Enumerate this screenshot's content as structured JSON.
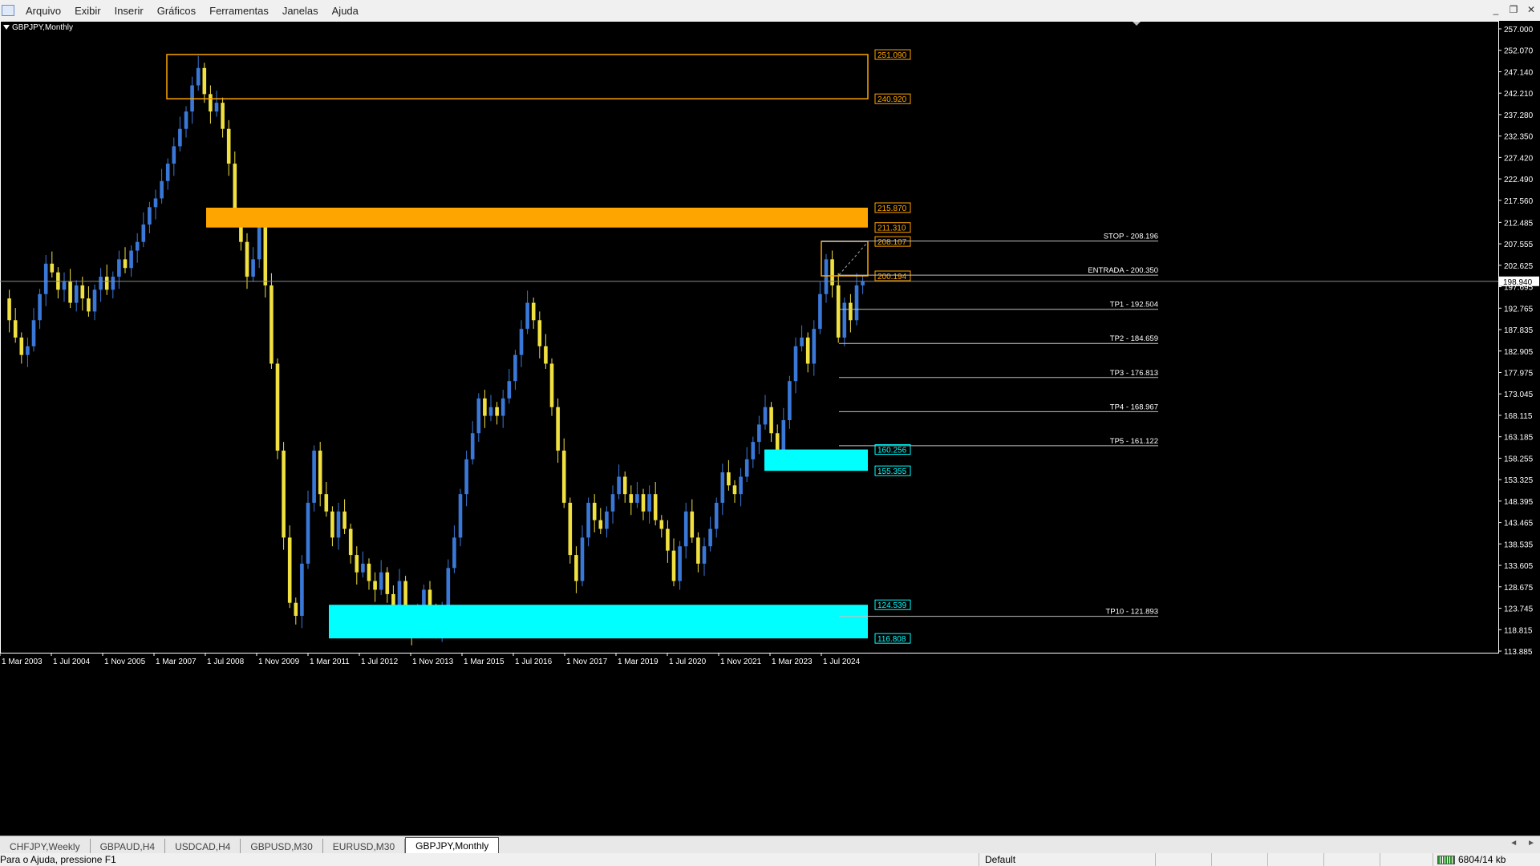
{
  "menu": {
    "items": [
      "Arquivo",
      "Exibir",
      "Inserir",
      "Gráficos",
      "Ferramentas",
      "Janelas",
      "Ajuda"
    ]
  },
  "chart": {
    "symbol": "GBPJPY,Monthly",
    "current_price": "198.940",
    "colors": {
      "background": "#000000",
      "bull": "#3a78d8",
      "bear": "#f0e040",
      "orange": "#ffa500",
      "cyan": "#00ffff",
      "line": "#c0c0c0"
    }
  },
  "chart_data": {
    "type": "candlestick",
    "y_ticks": [
      "257.000",
      "252.070",
      "247.140",
      "242.210",
      "237.280",
      "232.350",
      "227.420",
      "222.490",
      "217.560",
      "212.485",
      "207.555",
      "202.625",
      "197.695",
      "192.765",
      "187.835",
      "182.905",
      "177.975",
      "173.045",
      "168.115",
      "163.185",
      "158.255",
      "153.325",
      "148.395",
      "143.465",
      "138.535",
      "133.605",
      "128.675",
      "123.745",
      "118.815",
      "113.885"
    ],
    "ylim": [
      113.885,
      257.0
    ],
    "x_ticks": [
      "1 Mar 2003",
      "1 Jul 2004",
      "1 Nov 2005",
      "1 Mar 2007",
      "1 Jul 2008",
      "1 Nov 2009",
      "1 Mar 2011",
      "1 Jul 2012",
      "1 Nov 2013",
      "1 Mar 2015",
      "1 Jul 2016",
      "1 Nov 2017",
      "1 Mar 2019",
      "1 Jul 2020",
      "1 Nov 2021",
      "1 Mar 2023",
      "1 Jul 2024"
    ],
    "price_path": [
      [
        0,
        195
      ],
      [
        1,
        190
      ],
      [
        2,
        186
      ],
      [
        3,
        182
      ],
      [
        4,
        184
      ],
      [
        5,
        190
      ],
      [
        6,
        196
      ],
      [
        7,
        203
      ],
      [
        8,
        201
      ],
      [
        9,
        197
      ],
      [
        10,
        199
      ],
      [
        11,
        194
      ],
      [
        12,
        198
      ],
      [
        13,
        195
      ],
      [
        14,
        192
      ],
      [
        15,
        197
      ],
      [
        16,
        200
      ],
      [
        17,
        197
      ],
      [
        18,
        200
      ],
      [
        19,
        204
      ],
      [
        20,
        202
      ],
      [
        21,
        206
      ],
      [
        22,
        208
      ],
      [
        23,
        212
      ],
      [
        24,
        216
      ],
      [
        25,
        218
      ],
      [
        26,
        222
      ],
      [
        27,
        226
      ],
      [
        28,
        230
      ],
      [
        29,
        234
      ],
      [
        30,
        238
      ],
      [
        31,
        244
      ],
      [
        32,
        248
      ],
      [
        33,
        242
      ],
      [
        34,
        238
      ],
      [
        35,
        240
      ],
      [
        36,
        234
      ],
      [
        37,
        226
      ],
      [
        38,
        214
      ],
      [
        39,
        208
      ],
      [
        40,
        200
      ],
      [
        41,
        204
      ],
      [
        42,
        212
      ],
      [
        43,
        198
      ],
      [
        44,
        180
      ],
      [
        45,
        160
      ],
      [
        46,
        140
      ],
      [
        47,
        125
      ],
      [
        48,
        122
      ],
      [
        49,
        134
      ],
      [
        50,
        148
      ],
      [
        51,
        160
      ],
      [
        52,
        150
      ],
      [
        53,
        146
      ],
      [
        54,
        140
      ],
      [
        55,
        146
      ],
      [
        56,
        142
      ],
      [
        57,
        136
      ],
      [
        58,
        132
      ],
      [
        59,
        134
      ],
      [
        60,
        130
      ],
      [
        61,
        128
      ],
      [
        62,
        132
      ],
      [
        63,
        127
      ],
      [
        64,
        124
      ],
      [
        65,
        130
      ],
      [
        66,
        122
      ],
      [
        67,
        118
      ],
      [
        68,
        122
      ],
      [
        69,
        128
      ],
      [
        70,
        122
      ],
      [
        71,
        118
      ],
      [
        72,
        124
      ],
      [
        73,
        133
      ],
      [
        74,
        140
      ],
      [
        75,
        150
      ],
      [
        76,
        158
      ],
      [
        77,
        164
      ],
      [
        78,
        172
      ],
      [
        79,
        168
      ],
      [
        80,
        170
      ],
      [
        81,
        168
      ],
      [
        82,
        172
      ],
      [
        83,
        176
      ],
      [
        84,
        182
      ],
      [
        85,
        188
      ],
      [
        86,
        194
      ],
      [
        87,
        190
      ],
      [
        88,
        184
      ],
      [
        89,
        180
      ],
      [
        90,
        170
      ],
      [
        91,
        160
      ],
      [
        92,
        148
      ],
      [
        93,
        136
      ],
      [
        94,
        130
      ],
      [
        95,
        140
      ],
      [
        96,
        148
      ],
      [
        97,
        144
      ],
      [
        98,
        142
      ],
      [
        99,
        146
      ],
      [
        100,
        150
      ],
      [
        101,
        154
      ],
      [
        102,
        150
      ],
      [
        103,
        148
      ],
      [
        104,
        150
      ],
      [
        105,
        146
      ],
      [
        106,
        150
      ],
      [
        107,
        144
      ],
      [
        108,
        142
      ],
      [
        109,
        137
      ],
      [
        110,
        130
      ],
      [
        111,
        138
      ],
      [
        112,
        146
      ],
      [
        113,
        140
      ],
      [
        114,
        134
      ],
      [
        115,
        138
      ],
      [
        116,
        142
      ],
      [
        117,
        148
      ],
      [
        118,
        155
      ],
      [
        119,
        152
      ],
      [
        120,
        150
      ],
      [
        121,
        154
      ],
      [
        122,
        158
      ],
      [
        123,
        162
      ],
      [
        124,
        166
      ],
      [
        125,
        170
      ],
      [
        126,
        164
      ],
      [
        127,
        160
      ],
      [
        128,
        167
      ],
      [
        129,
        176
      ],
      [
        130,
        184
      ],
      [
        131,
        186
      ],
      [
        132,
        180
      ],
      [
        133,
        188
      ],
      [
        134,
        196
      ],
      [
        135,
        204
      ],
      [
        136,
        198
      ],
      [
        137,
        186
      ],
      [
        138,
        194
      ],
      [
        139,
        190
      ],
      [
        140,
        198
      ],
      [
        141,
        199
      ]
    ],
    "zones": [
      {
        "top": "251.090",
        "bottom": "240.920",
        "style": "outline",
        "color": "#ffa500"
      },
      {
        "top": "215.870",
        "bottom": "211.310",
        "style": "filled",
        "color": "#ffa500"
      },
      {
        "top": "208.107",
        "bottom": "200.194",
        "style": "outline",
        "color": "#ffa500"
      },
      {
        "top": "160.256",
        "bottom": "155.355",
        "style": "filled",
        "color": "#00ffff"
      },
      {
        "top": "124.539",
        "bottom": "116.808",
        "style": "filled",
        "color": "#00ffff"
      }
    ],
    "levels": [
      {
        "label": "STOP - 208.196",
        "value": 208.196
      },
      {
        "label": "ENTRADA - 200.350",
        "value": 200.35
      },
      {
        "label": "TP1 - 192.504",
        "value": 192.504
      },
      {
        "label": "TP2 - 184.659",
        "value": 184.659
      },
      {
        "label": "TP3 - 176.813",
        "value": 176.813
      },
      {
        "label": "TP4 - 168.967",
        "value": 168.967
      },
      {
        "label": "TP5 - 161.122",
        "value": 161.122
      },
      {
        "label": "TP10 - 121.893",
        "value": 121.893
      }
    ]
  },
  "tabs": [
    "CHFJPY,Weekly",
    "GBPAUD,H4",
    "USDCAD,H4",
    "GBPUSD,M30",
    "EURUSD,M30",
    "GBPJPY,Monthly"
  ],
  "status": {
    "help": "Para o Ajuda, pressione F1",
    "profile": "Default",
    "traffic": "6804/14 kb"
  }
}
